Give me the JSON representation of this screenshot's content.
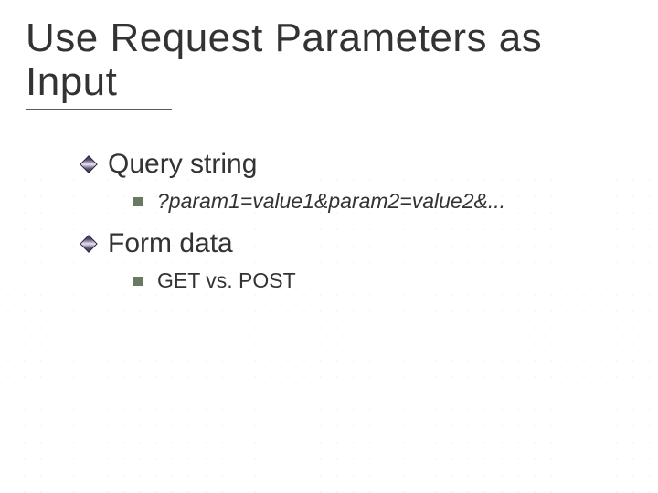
{
  "title": "Use Request Parameters as Input",
  "bullets": {
    "b1": {
      "label": "Query string",
      "sub": "?param1=value1&param2=value2&..."
    },
    "b2": {
      "label": "Form data",
      "sub": "GET vs. POST"
    }
  }
}
